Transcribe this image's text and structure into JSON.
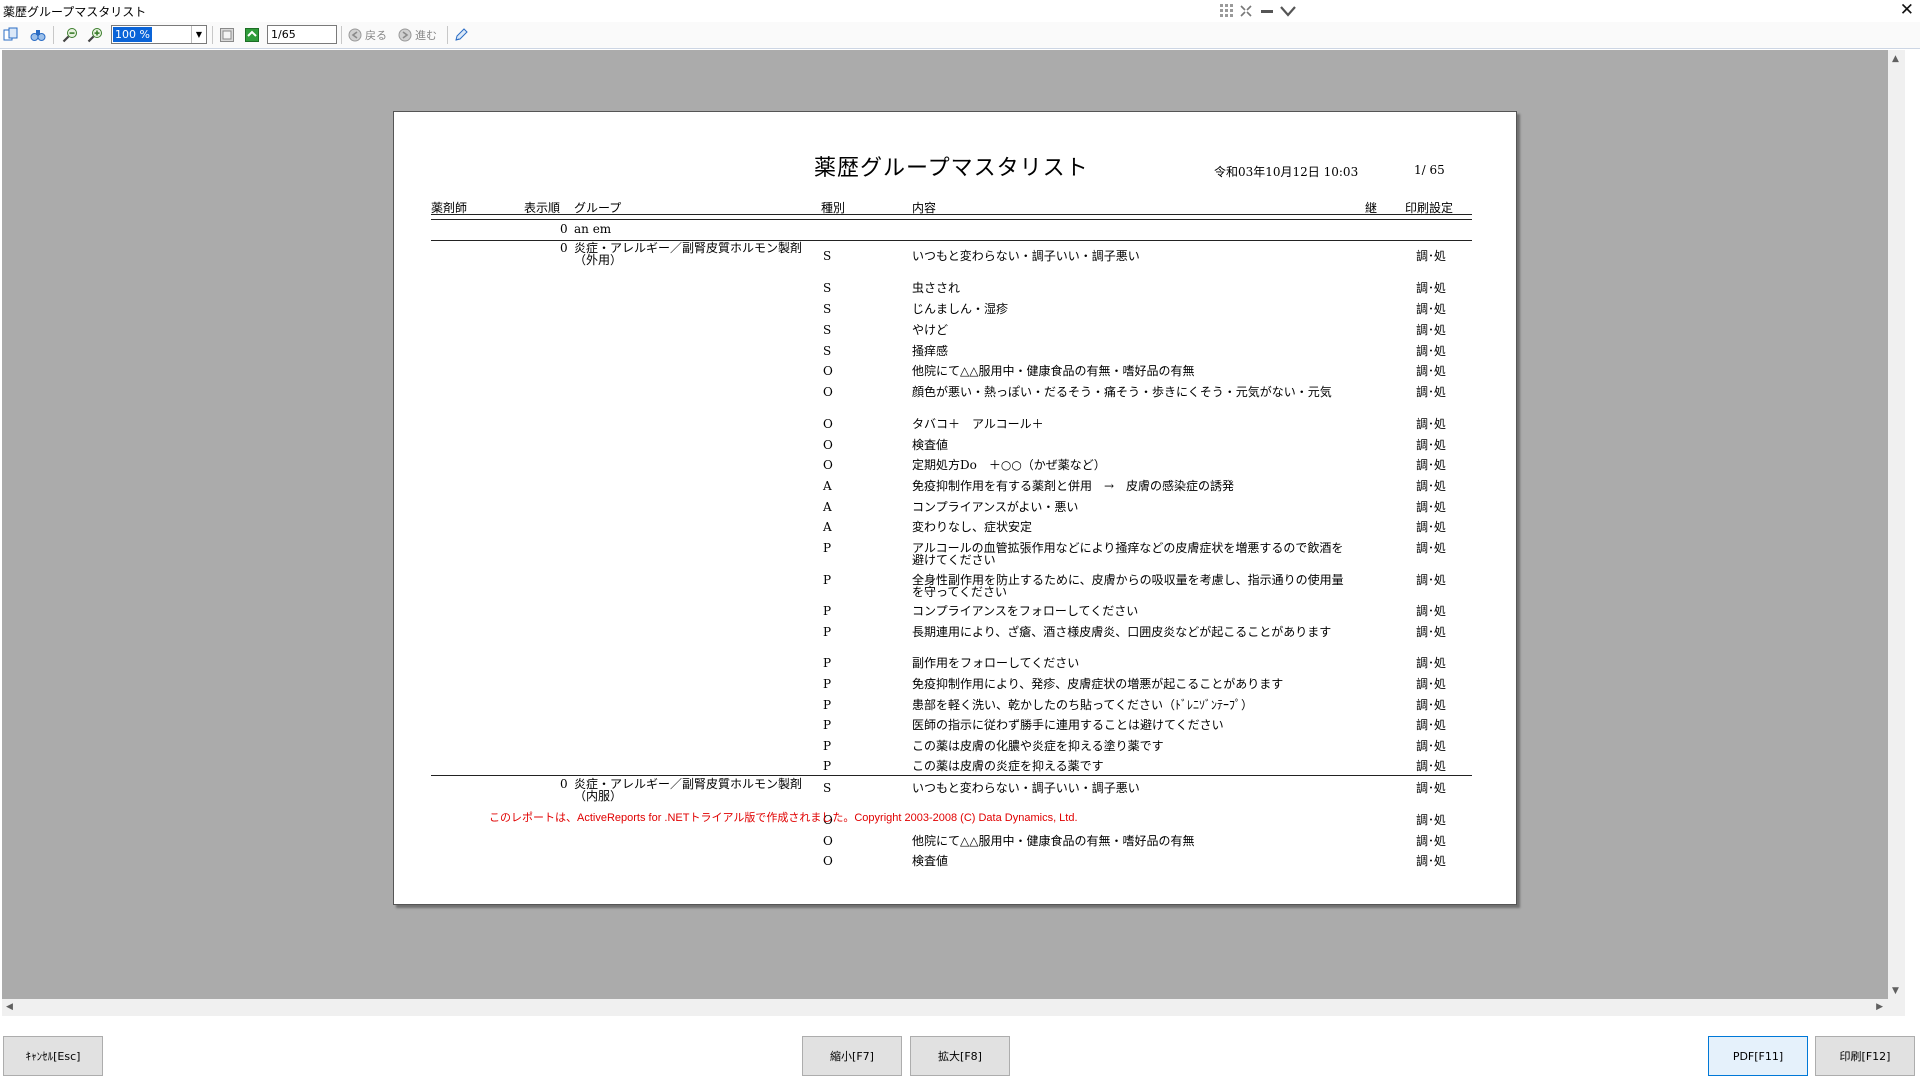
{
  "window": {
    "title": "薬歴グループマスタリスト"
  },
  "toolbar": {
    "zoom": "100 %",
    "page": "1/65",
    "back_label": "戻る",
    "forward_label": "進む"
  },
  "report": {
    "title": "薬歴グループマスタリスト",
    "date": "令和03年10月12日 10:03",
    "page": "1/ 65",
    "headers": {
      "pharmacist": "薬剤師",
      "order": "表示順",
      "group": "グループ",
      "kind": "種別",
      "content": "内容",
      "cont": "継",
      "print": "印刷設定"
    },
    "groups": [
      {
        "order": "0",
        "name": "an em"
      },
      {
        "order": "0",
        "name": "炎症・アレルギー／副腎皮質ホルモン製剤（外用）"
      },
      {
        "order": "0",
        "name": "炎症・アレルギー／副腎皮質ホルモン製剤（内服）"
      }
    ],
    "rows": [
      {
        "kind": "S",
        "content": "いつもと変わらない・調子いい・調子悪い",
        "print": "調･処"
      },
      {
        "kind": "S",
        "content": "虫さされ",
        "print": "調･処"
      },
      {
        "kind": "S",
        "content": "じんましん・湿疹",
        "print": "調･処"
      },
      {
        "kind": "S",
        "content": "やけど",
        "print": "調･処"
      },
      {
        "kind": "S",
        "content": "掻痒感",
        "print": "調･処"
      },
      {
        "kind": "O",
        "content": "他院にて△△服用中・健康食品の有無・嗜好品の有無",
        "print": "調･処"
      },
      {
        "kind": "O",
        "content": "顔色が悪い・熱っぽい・だるそう・痛そう・歩きにくそう・元気がない・元気",
        "print": "調･処"
      },
      {
        "kind": "O",
        "content": "タバコ＋　アルコール＋",
        "print": "調･処"
      },
      {
        "kind": "O",
        "content": "検査値",
        "print": "調･処"
      },
      {
        "kind": "O",
        "content": "定期処方Do　＋○○（かぜ薬など）",
        "print": "調･処"
      },
      {
        "kind": "A",
        "content": "免疫抑制作用を有する薬剤と併用　→　皮膚の感染症の誘発",
        "print": "調･処"
      },
      {
        "kind": "A",
        "content": "コンプライアンスがよい・悪い",
        "print": "調･処"
      },
      {
        "kind": "A",
        "content": "変わりなし、症状安定",
        "print": "調･処"
      },
      {
        "kind": "P",
        "content": "アルコールの血管拡張作用などにより掻痒などの皮膚症状を増悪するので飲酒を避けてください",
        "print": "調･処"
      },
      {
        "kind": "P",
        "content": "全身性副作用を防止するために、皮膚からの吸収量を考慮し、指示通りの使用量を守ってください",
        "print": "調･処"
      },
      {
        "kind": "P",
        "content": "コンプライアンスをフォローしてください",
        "print": "調･処"
      },
      {
        "kind": "P",
        "content": "長期連用により、ざ瘡、酒さ様皮膚炎、口囲皮炎などが起こることがあります",
        "print": "調･処"
      },
      {
        "kind": "P",
        "content": "副作用をフォローしてください",
        "print": "調･処"
      },
      {
        "kind": "P",
        "content": "免疫抑制作用により、発疹、皮膚症状の増悪が起こることがあります",
        "print": "調･処"
      },
      {
        "kind": "P",
        "content": "患部を軽く洗い、乾かしたのち貼ってください（ﾄﾞﾚﾆｿﾞﾝﾃｰﾌﾟ）",
        "print": "調･処"
      },
      {
        "kind": "P",
        "content": "医師の指示に従わず勝手に連用することは避けてください",
        "print": "調･処"
      },
      {
        "kind": "P",
        "content": "この薬は皮膚の化膿や炎症を抑える塗り薬です",
        "print": "調･処"
      },
      {
        "kind": "P",
        "content": "この薬は皮膚の炎症を抑える薬です",
        "print": "調･処"
      },
      {
        "kind": "S",
        "content": "いつもと変わらない・調子いい・調子悪い",
        "print": "調･処"
      },
      {
        "kind": "O",
        "content": "",
        "print": "調･処"
      },
      {
        "kind": "O",
        "content": "他院にて△△服用中・健康食品の有無・嗜好品の有無",
        "print": "調･処"
      },
      {
        "kind": "O",
        "content": "検査値",
        "print": "調･処"
      }
    ],
    "watermark": "このレポートは、ActiveReports for .NETトライアル版で作成されました。Copyright 2003-2008 (C) Data Dynamics, Ltd."
  },
  "buttons": {
    "cancel": "ｷｬﾝｾﾙ[Esc]",
    "zoom_out": "縮小[F7]",
    "zoom_in": "拡大[F8]",
    "pdf": "PDF[F11]",
    "print": "印刷[F12]"
  }
}
